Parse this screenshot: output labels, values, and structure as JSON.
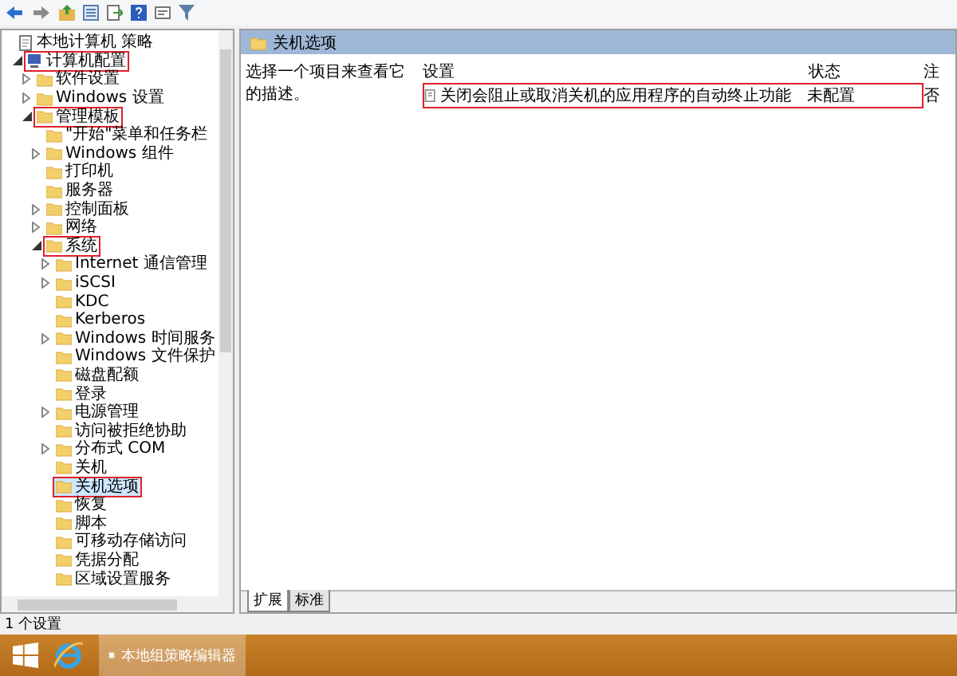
{
  "tree": {
    "items": [
      {
        "label": "本地计算机 策略",
        "kind": "document",
        "selected": false,
        "highlighted": false,
        "children": [
          {
            "label": "计算机配置",
            "kind": "computer",
            "expanded": true,
            "selected": false,
            "highlighted": true,
            "children": [
              {
                "label": "软件设置",
                "kind": "folder",
                "expanded": false,
                "selected": false,
                "highlighted": false
              },
              {
                "label": "Windows 设置",
                "kind": "folder",
                "expanded": false,
                "selected": false,
                "highlighted": false
              },
              {
                "label": "管理模板",
                "kind": "folder",
                "expanded": true,
                "selected": false,
                "highlighted": true,
                "children": [
                  {
                    "label": "\"开始\"菜单和任务栏",
                    "kind": "folder",
                    "selected": false,
                    "highlighted": false
                  },
                  {
                    "label": "Windows 组件",
                    "kind": "folder",
                    "expanded": false,
                    "selected": false,
                    "highlighted": false
                  },
                  {
                    "label": "打印机",
                    "kind": "folder",
                    "selected": false,
                    "highlighted": false
                  },
                  {
                    "label": "服务器",
                    "kind": "folder",
                    "selected": false,
                    "highlighted": false
                  },
                  {
                    "label": "控制面板",
                    "kind": "folder",
                    "expanded": false,
                    "selected": false,
                    "highlighted": false
                  },
                  {
                    "label": "网络",
                    "kind": "folder",
                    "expanded": false,
                    "selected": false,
                    "highlighted": false
                  },
                  {
                    "label": "系统",
                    "kind": "folder",
                    "expanded": true,
                    "selected": false,
                    "highlighted": true,
                    "children": [
                      {
                        "label": "Internet 通信管理",
                        "kind": "folder",
                        "expanded": false,
                        "selected": false,
                        "highlighted": false
                      },
                      {
                        "label": "iSCSI",
                        "kind": "folder",
                        "expanded": false,
                        "selected": false,
                        "highlighted": false
                      },
                      {
                        "label": "KDC",
                        "kind": "folder",
                        "selected": false,
                        "highlighted": false
                      },
                      {
                        "label": "Kerberos",
                        "kind": "folder",
                        "selected": false,
                        "highlighted": false
                      },
                      {
                        "label": "Windows 时间服务",
                        "kind": "folder",
                        "expanded": false,
                        "selected": false,
                        "highlighted": false
                      },
                      {
                        "label": "Windows 文件保护",
                        "kind": "folder",
                        "selected": false,
                        "highlighted": false
                      },
                      {
                        "label": "磁盘配额",
                        "kind": "folder",
                        "selected": false,
                        "highlighted": false
                      },
                      {
                        "label": "登录",
                        "kind": "folder",
                        "selected": false,
                        "highlighted": false
                      },
                      {
                        "label": "电源管理",
                        "kind": "folder",
                        "expanded": false,
                        "selected": false,
                        "highlighted": false
                      },
                      {
                        "label": "访问被拒绝协助",
                        "kind": "folder",
                        "selected": false,
                        "highlighted": false
                      },
                      {
                        "label": "分布式 COM",
                        "kind": "folder",
                        "expanded": false,
                        "selected": false,
                        "highlighted": false
                      },
                      {
                        "label": "关机",
                        "kind": "folder",
                        "selected": false,
                        "highlighted": false
                      },
                      {
                        "label": "关机选项",
                        "kind": "folder",
                        "selected": true,
                        "highlighted": true
                      },
                      {
                        "label": "恢复",
                        "kind": "folder",
                        "selected": false,
                        "highlighted": false
                      },
                      {
                        "label": "脚本",
                        "kind": "folder",
                        "selected": false,
                        "highlighted": false
                      },
                      {
                        "label": "可移动存储访问",
                        "kind": "folder",
                        "selected": false,
                        "highlighted": false
                      },
                      {
                        "label": "凭据分配",
                        "kind": "folder",
                        "selected": false,
                        "highlighted": false
                      },
                      {
                        "label": "区域设置服务",
                        "kind": "folder",
                        "selected": false,
                        "highlighted": false
                      }
                    ]
                  }
                ]
              }
            ]
          }
        ]
      }
    ]
  },
  "detail": {
    "title": "关机选项",
    "description": "选择一个项目来查看它的描述。",
    "table": {
      "columns": [
        "设置",
        "状态",
        "注"
      ],
      "rows": [
        {
          "cells": [
            "关闭会阻止或取消关机的应用程序的自动终止功能",
            "未配置",
            "否"
          ],
          "highlighted": true
        }
      ]
    },
    "tabs": [
      {
        "label": "扩展",
        "selected": true
      },
      {
        "label": "标准",
        "selected": false
      }
    ]
  },
  "status_bar": "1 个设置",
  "taskbar": {
    "apps": [
      {
        "label": "本地组策略编辑器",
        "selected": true
      }
    ]
  }
}
